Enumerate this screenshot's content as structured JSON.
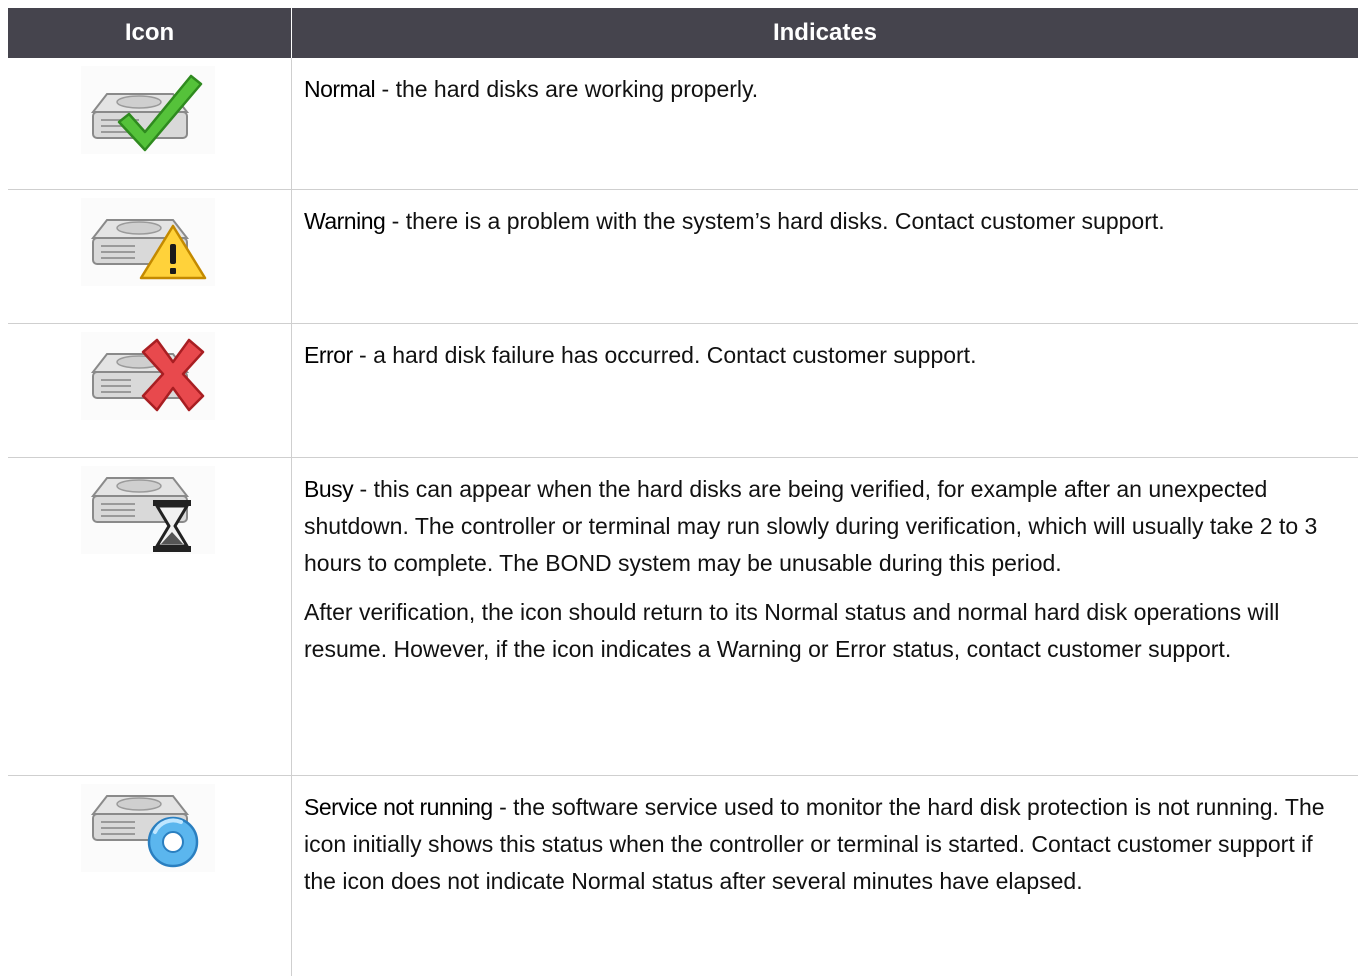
{
  "table": {
    "header": {
      "icon": "Icon",
      "indicates": "Indicates"
    },
    "rows": [
      {
        "icon": "hard-disk-normal-icon",
        "term": "Normal",
        "text": " - the hard disks are working properly."
      },
      {
        "icon": "hard-disk-warning-icon",
        "term": "Warning",
        "text": " - there is a problem with the system’s hard disks. Contact customer support."
      },
      {
        "icon": "hard-disk-error-icon",
        "term": "Error",
        "text": " - a hard disk failure has occurred. Contact customer support."
      },
      {
        "icon": "hard-disk-busy-icon",
        "term": "Busy",
        "text": " - this can appear when the hard disks are being verified, for example after an unexpected shutdown. The controller or terminal may run slowly during verification, which will usually take 2 to 3 hours to complete. The BOND system may be unusable during this period.",
        "text2": "After verification, the icon should return to its Normal status and normal hard disk operations will resume. However, if the icon indicates a Warning or Error status, contact customer support."
      },
      {
        "icon": "hard-disk-service-not-running-icon",
        "term": "Service not running",
        "text": " - the software service used to monitor the hard disk protection is not running. The icon initially shows this status when the controller or terminal is started. Contact customer support if the icon does not indicate Normal status after several minutes have elapsed."
      }
    ]
  }
}
